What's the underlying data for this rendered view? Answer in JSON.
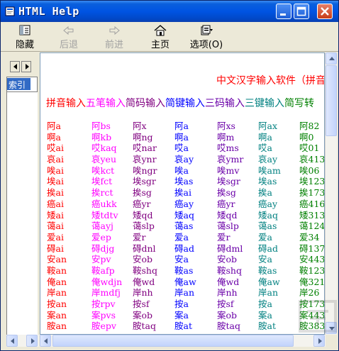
{
  "window": {
    "title": "HTML Help"
  },
  "toolbar": {
    "hide": "隐藏",
    "back": "后退",
    "forward": "前进",
    "home": "主页",
    "options": "选项(O)"
  },
  "left_pane": {
    "tab_label": "索引"
  },
  "content": {
    "heading": "中文汉字输入软件（拼音",
    "methods": [
      {
        "label": "拼音输入",
        "color": "#ff0000"
      },
      {
        "label": "五笔输入",
        "color": "#ff00ff"
      },
      {
        "label": "简码输入",
        "color": "#800080"
      },
      {
        "label": "简键输入",
        "color": "#0000ff"
      },
      {
        "label": "三码输入",
        "color": "#6a00a8"
      },
      {
        "label": "三键输入",
        "color": "#008080"
      },
      {
        "label": "简写转",
        "color": "#008000"
      }
    ],
    "rows": [
      [
        "阿a",
        "阿bs",
        "阿x",
        "阿a",
        "阿xs",
        "阿ax",
        "阿82"
      ],
      [
        "啊a",
        "啊kb",
        "啊ng",
        "啊a",
        "啊m",
        "啊a",
        "啊0"
      ],
      [
        "哎ai",
        "哎kaq",
        "哎nar",
        "哎a",
        "哎ms",
        "哎a",
        "哎01"
      ],
      [
        "哀ai",
        "哀yeu",
        "哀ynr",
        "哀ay",
        "哀ymr",
        "哀ay",
        "哀413"
      ],
      [
        "唉ai",
        "唉kct",
        "唉ngr",
        "唉a",
        "唉mv",
        "唉am",
        "唉06"
      ],
      [
        "埃ai",
        "埃fct",
        "埃sgr",
        "埃as",
        "埃sgr",
        "埃as",
        "埃123"
      ],
      [
        "挨ai",
        "挨rct",
        "挨sg",
        "挨ai",
        "挨sg",
        "挨a",
        "挨173"
      ],
      [
        "癌ai",
        "癌ukk",
        "癌yr",
        "癌ay",
        "癌yr",
        "癌ay",
        "癌416"
      ],
      [
        "矮ai",
        "矮tdtv",
        "矮qd",
        "矮aq",
        "矮qd",
        "矮aq",
        "矮313"
      ],
      [
        "蔼ai",
        "蔼ayj",
        "蔼slp",
        "蔼as",
        "蔼slp",
        "蔼as",
        "蔼124"
      ],
      [
        "爱ai",
        "爱ep",
        "爱r",
        "爱a",
        "爱r",
        "爱a",
        "爱34"
      ],
      [
        "碍ai",
        "碍djg",
        "碍dnl",
        "碍ad",
        "碍dml",
        "碍ad",
        "碍137"
      ],
      [
        "安an",
        "安pv",
        "安ob",
        "安a",
        "安ob",
        "安a",
        "安443"
      ],
      [
        "鞍an",
        "鞍afp",
        "鞍shq",
        "鞍as",
        "鞍shq",
        "鞍as",
        "鞍123"
      ],
      [
        "俺an",
        "俺wdjn",
        "俺wd",
        "俺aw",
        "俺wd",
        "俺aw",
        "俺321"
      ],
      [
        "岸an",
        "岸mdfj",
        "岸nh",
        "岸an",
        "岸nh",
        "岸an",
        "岸26"
      ],
      [
        "按an",
        "按rpv",
        "按sf",
        "按a",
        "按sf",
        "按a",
        "按173"
      ],
      [
        "案an",
        "案pvs",
        "案ob",
        "案a",
        "案ob",
        "案a",
        "案443"
      ],
      [
        "胺an",
        "胺epv",
        "胺taq",
        "胺at",
        "胺taq",
        "胺at",
        "胺383"
      ]
    ]
  }
}
